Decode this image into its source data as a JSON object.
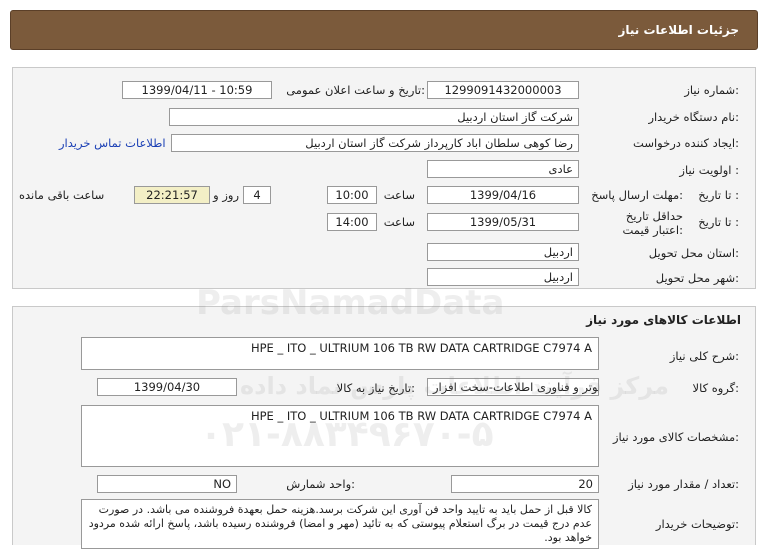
{
  "header": {
    "title": "جزئیات اطلاعات نیاز"
  },
  "need": {
    "number_label": "شماره نیاز:",
    "number": "1299091432000003",
    "announce_label": "تاریخ و ساعت اعلان عمومی:",
    "announce_value": "1399/04/11 - 10:59",
    "buyer_org_label": "نام دستگاه خریدار:",
    "buyer_org": "شرکت گاز استان اردبیل",
    "creator_label": "ایجاد کننده درخواست:",
    "creator": "رضا کوهی سلطان اباد کارپرداز شرکت گاز استان اردبیل",
    "contact_link": "اطلاعات تماس خریدار",
    "priority_label": "اولویت نیاز :",
    "priority": "عادی",
    "deadline_label": "مهلت ارسال پاسخ:",
    "to_date_label": "تا تاریخ :",
    "deadline_date": "1399/04/16",
    "time_label": "ساعت",
    "deadline_time": "10:00",
    "days": "4",
    "days_label": "روز و",
    "remaining_time": "22:21:57",
    "remaining_label": "ساعت باقی مانده",
    "validity_label": "حداقل تاریخ اعتبار قیمت:",
    "validity_date": "1399/05/31",
    "validity_time": "14:00",
    "province_label": "استان محل تحویل:",
    "province": "اردبیل",
    "city_label": "شهر محل تحویل:",
    "city": "اردبیل"
  },
  "goods": {
    "section_title": "اطلاعات کالاهای مورد نیاز",
    "summary_label": "شرح کلی نیاز:",
    "summary": "HPE _ ITO _ ULTRIUM  106  TB  RW  DATA CARTRIDGE  C7974 A",
    "group_label": "گروه کالا:",
    "group": "کامپیوتر و فناوری اطلاعات-سخت افزار",
    "need_date_label": "تاریخ نیاز به کالا:",
    "need_date": "1399/04/30",
    "specs_label": "مشخصات کالای مورد نیاز:",
    "specs": "HPE _ ITO _ ULTRIUM  106  TB  RW  DATA CARTRIDGE  C7974 A",
    "quantity_label": "تعداد / مقدار مورد نیاز:",
    "quantity": "20",
    "unit_label": "واحد شمارش:",
    "unit": "NO",
    "buyer_notes_label": "توضیحات خریدار:",
    "buyer_notes": "کالا قبل از حمل باید به تایید واحد فن آوری این شرکت برسد.هزینه حمل بعهدة فروشنده می باشد. در صورت عدم درج قیمت در برگ استعلام پیوستی که به تائید (مهر و امضا) فروشنده رسیده باشد، پاسخ ارائه شده مردود خواهد بود."
  },
  "watermark": {
    "brand": "ParsNamadData",
    "fa": "مرکز فرآیند اطلاعات پارس نماد داده",
    "phone": "۰۲۱-۸۸۳۴۹۶۷۰-۵"
  }
}
